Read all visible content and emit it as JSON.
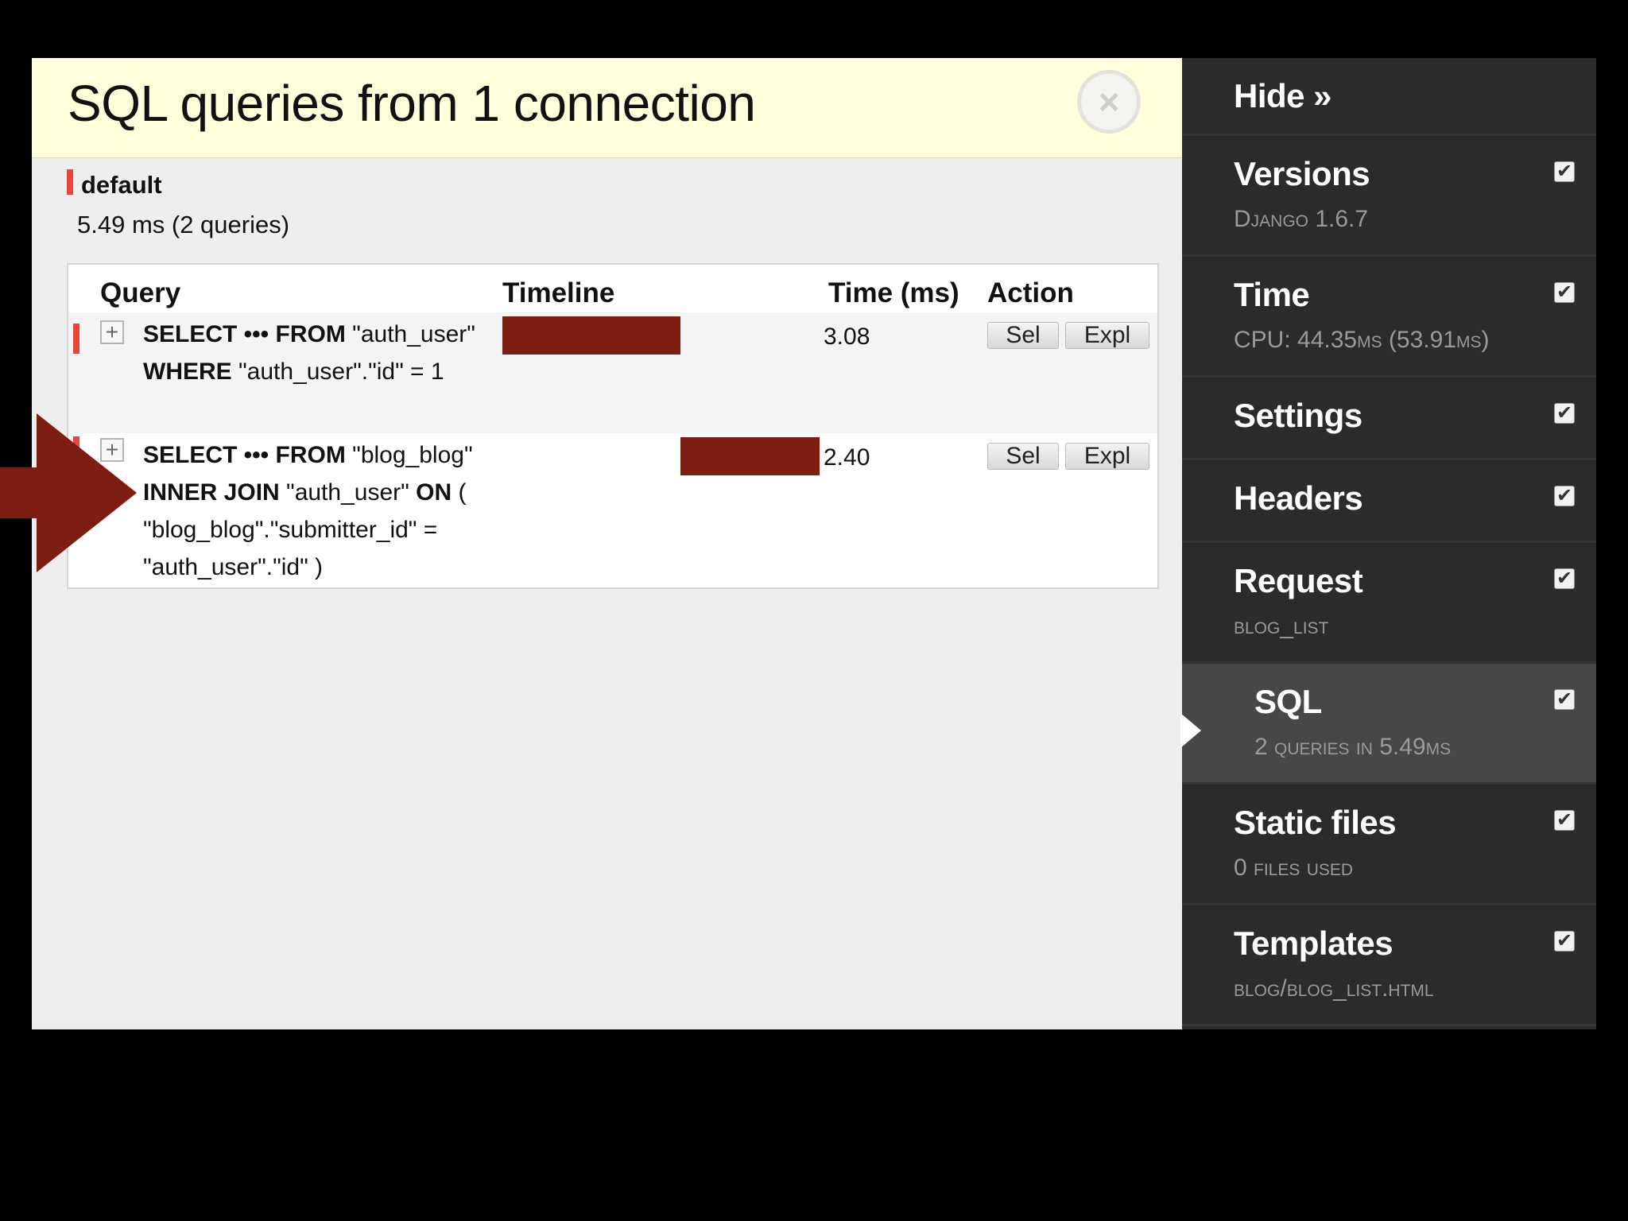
{
  "panel": {
    "title": "SQL queries from 1 connection",
    "close_icon": "×",
    "connection": {
      "name": "default",
      "stats": "5.49 ms (2 queries)"
    },
    "table": {
      "headers": {
        "query": "Query",
        "timeline": "Timeline",
        "time": "Time (ms)",
        "action": "Action"
      },
      "toggle_symbol": "+",
      "rows": [
        {
          "sql_html": "<b>SELECT ••• FROM</b> \"auth_user\" <b>WHERE</b> \"auth_user\".\"id\" = 1",
          "time": "3.08",
          "timeline_start_ms": 0,
          "timeline_duration_ms": 3.08,
          "sel_label": "Sel",
          "expl_label": "Expl"
        },
        {
          "sql_html": "<b>SELECT ••• FROM</b> \"blog_blog\" <b>INNER JOIN</b> \"auth_user\" <b>ON</b> ( \"blog_blog\".\"submitter_id\" = \"auth_user\".\"id\" )",
          "time": "2.40",
          "timeline_start_ms": 3.08,
          "timeline_duration_ms": 2.4,
          "sel_label": "Sel",
          "expl_label": "Expl"
        }
      ],
      "timeline_total_ms": 5.48
    }
  },
  "annotation": {
    "icon": "arrow-right-icon",
    "color": "#7d1e14"
  },
  "sidebar": {
    "hide_label": "Hide »",
    "check_symbol": "✔",
    "items": [
      {
        "title": "Versions",
        "subtitle": "Django 1.6.7",
        "checked": true
      },
      {
        "title": "Time",
        "subtitle": "CPU: 44.35ms (53.91ms)",
        "checked": true
      },
      {
        "title": "Settings",
        "subtitle": "",
        "checked": true
      },
      {
        "title": "Headers",
        "subtitle": "",
        "checked": true
      },
      {
        "title": "Request",
        "subtitle": "blog_list",
        "checked": true
      },
      {
        "title": "SQL",
        "subtitle": "2 queries in 5.49ms",
        "checked": true,
        "active": true
      },
      {
        "title": "Static files",
        "subtitle": "0 files used",
        "checked": true
      },
      {
        "title": "Templates",
        "subtitle": "blog/blog_list.html",
        "checked": true
      }
    ]
  },
  "colors": {
    "header_bg": "#ffffdc",
    "timeline_bar": "#7d1e14",
    "row_marker": "#e8463b",
    "sidebar_bg": "#2b2b2b",
    "sidebar_active": "#474747"
  }
}
